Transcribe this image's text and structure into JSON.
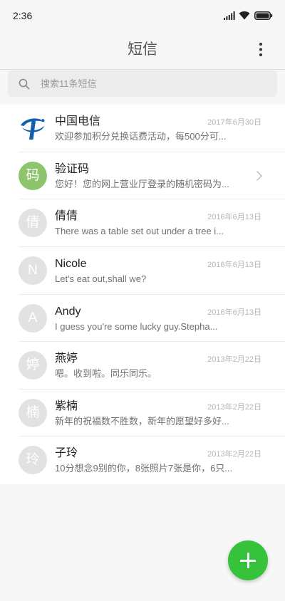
{
  "status_bar": {
    "time": "2:36",
    "icons": [
      "signal-icon",
      "wifi-icon",
      "battery-icon"
    ]
  },
  "header": {
    "title": "短信",
    "menu_icon": "more-vertical-icon"
  },
  "search": {
    "icon": "search-icon",
    "placeholder": "搜索11条短信"
  },
  "conversations": [
    {
      "name": "中国电信",
      "avatar_icon": "china-telecom-logo-icon",
      "date": "2017年6月30日",
      "preview": "欢迎参加积分兑换话费活动，每500分可..."
    },
    {
      "name": "验证码",
      "avatar_text": "码",
      "avatar_color": "#8dc46c",
      "trailing_icon": "chevron-right-icon",
      "preview": "您好！您的网上营业厅登录的随机密码为..."
    },
    {
      "name": "倩倩",
      "avatar_text": "倩",
      "avatar_color": "#e2e2e2",
      "date": "2016年6月13日",
      "preview": "There was a table set out under a tree i..."
    },
    {
      "name": "Nicole",
      "avatar_text": "N",
      "avatar_color": "#e2e2e2",
      "date": "2016年6月13日",
      "preview": "Let's eat out,shall we?"
    },
    {
      "name": "Andy",
      "avatar_text": "A",
      "avatar_color": "#e2e2e2",
      "date": "2016年6月13日",
      "preview": "I guess you're some lucky guy.Stepha..."
    },
    {
      "name": "燕婷",
      "avatar_text": "婷",
      "avatar_color": "#e2e2e2",
      "date": "2013年2月22日",
      "preview": "嗯。收到啦。同乐同乐。"
    },
    {
      "name": "紫楠",
      "avatar_text": "楠",
      "avatar_color": "#e2e2e2",
      "date": "2013年2月22日",
      "preview": "新年的祝福数不胜数，新年的愿望好多好..."
    },
    {
      "name": "子玲",
      "avatar_text": "玲",
      "avatar_color": "#e2e2e2",
      "date": "2013年2月22日",
      "preview": "10分想念9别的你，8张照片7张是你，6只..."
    }
  ],
  "fab": {
    "icon": "plus-icon",
    "color": "#36c33b"
  },
  "colors": {
    "background": "#f7f7f7",
    "list_background": "#ffffff",
    "search_background": "#ececec"
  }
}
